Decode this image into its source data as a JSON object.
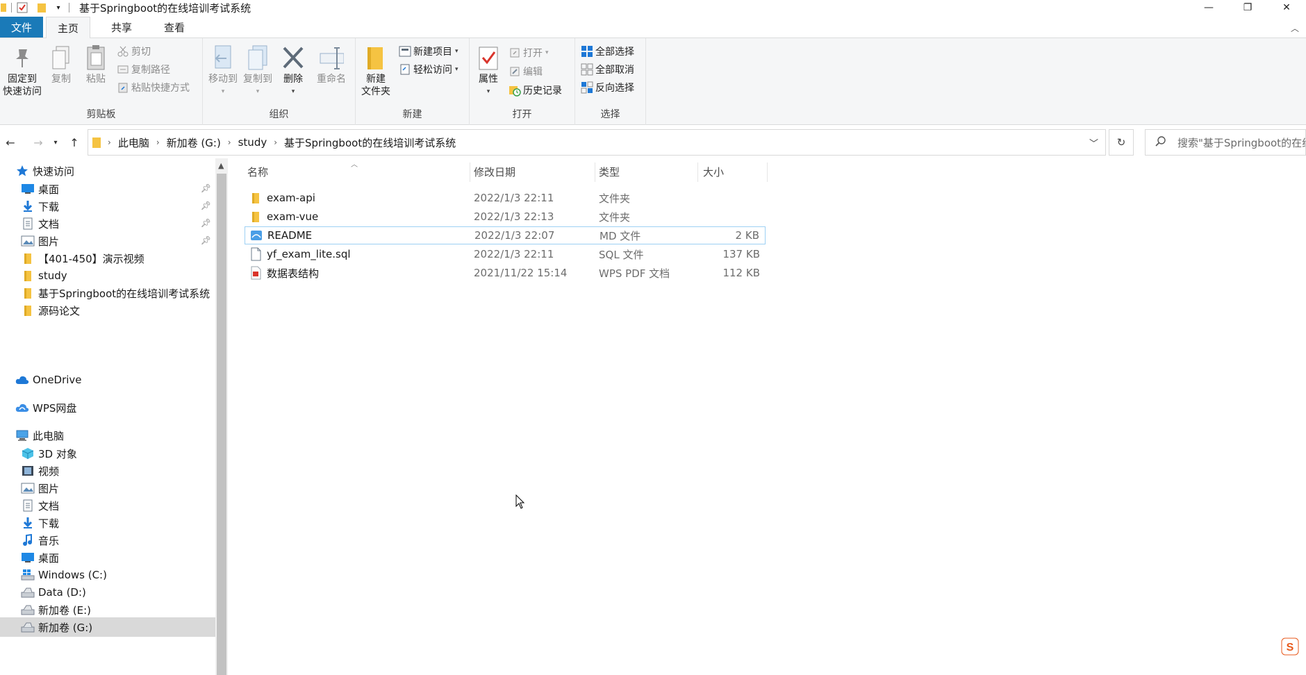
{
  "window": {
    "title": "基于Springboot的在线培训考试系统",
    "controls": {
      "minimize": "—",
      "maximize": "❐",
      "close": "✕"
    }
  },
  "ribbon": {
    "tabs": [
      "文件",
      "主页",
      "共享",
      "查看"
    ],
    "active_tab": "主页",
    "groups": {
      "clipboard": {
        "label": "剪贴板",
        "pin_line1": "固定到",
        "pin_line2": "快速访问",
        "copy": "复制",
        "paste": "粘贴",
        "cut": "剪切",
        "copy_path": "复制路径",
        "paste_shortcut": "粘贴快捷方式"
      },
      "organize": {
        "label": "组织",
        "move_to": "移动到",
        "copy_to": "复制到",
        "delete": "删除",
        "rename": "重命名"
      },
      "new": {
        "label": "新建",
        "new_folder_line1": "新建",
        "new_folder_line2": "文件夹",
        "new_item": "新建项目",
        "easy_access": "轻松访问"
      },
      "open": {
        "label": "打开",
        "properties": "属性",
        "open": "打开",
        "edit": "编辑",
        "history": "历史记录"
      },
      "select": {
        "label": "选择",
        "select_all": "全部选择",
        "select_none": "全部取消",
        "invert": "反向选择"
      }
    }
  },
  "address": {
    "crumbs": [
      "此电脑",
      "新加卷 (G:)",
      "study",
      "基于Springboot的在线培训考试系统"
    ],
    "search_placeholder": "搜索\"基于Springboot的在线培训考试系统\""
  },
  "navpane": {
    "quick_access": "快速访问",
    "quick_items": [
      {
        "label": "桌面",
        "icon": "desktop-icon",
        "pinned": true
      },
      {
        "label": "下载",
        "icon": "download-icon",
        "pinned": true
      },
      {
        "label": "文档",
        "icon": "document-icon",
        "pinned": true
      },
      {
        "label": "图片",
        "icon": "picture-icon",
        "pinned": true
      },
      {
        "label": "【401-450】演示视频",
        "icon": "folder-icon",
        "pinned": false
      },
      {
        "label": "study",
        "icon": "folder-icon",
        "pinned": false
      },
      {
        "label": "基于Springboot的在线培训考试系统",
        "icon": "folder-icon",
        "pinned": false
      },
      {
        "label": "源码论文",
        "icon": "folder-icon",
        "pinned": false
      }
    ],
    "onedrive": "OneDrive",
    "wps": "WPS网盘",
    "this_pc": "此电脑",
    "pc_items": [
      {
        "label": "3D 对象",
        "icon": "3d-objects-icon"
      },
      {
        "label": "视频",
        "icon": "video-icon"
      },
      {
        "label": "图片",
        "icon": "picture-icon"
      },
      {
        "label": "文档",
        "icon": "document-icon"
      },
      {
        "label": "下载",
        "icon": "download-icon"
      },
      {
        "label": "音乐",
        "icon": "music-icon"
      },
      {
        "label": "桌面",
        "icon": "desktop-icon"
      },
      {
        "label": "Windows (C:)",
        "icon": "windows-drive-icon"
      },
      {
        "label": "Data (D:)",
        "icon": "drive-icon"
      },
      {
        "label": "新加卷 (E:)",
        "icon": "drive-icon"
      },
      {
        "label": "新加卷 (G:)",
        "icon": "drive-icon"
      }
    ]
  },
  "filelist": {
    "columns": [
      "名称",
      "修改日期",
      "类型",
      "大小"
    ],
    "rows": [
      {
        "name": "exam-api",
        "date": "2022/1/3 22:11",
        "type": "文件夹",
        "size": "",
        "icon": "folder-icon"
      },
      {
        "name": "exam-vue",
        "date": "2022/1/3 22:13",
        "type": "文件夹",
        "size": "",
        "icon": "folder-icon"
      },
      {
        "name": "README",
        "date": "2022/1/3 22:07",
        "type": "MD 文件",
        "size": "2 KB",
        "icon": "md-file-icon"
      },
      {
        "name": "yf_exam_lite.sql",
        "date": "2022/1/3 22:11",
        "type": "SQL 文件",
        "size": "137 KB",
        "icon": "sql-file-icon"
      },
      {
        "name": "数据表结构",
        "date": "2021/11/22 15:14",
        "type": "WPS PDF 文档",
        "size": "112 KB",
        "icon": "pdf-file-icon"
      }
    ]
  },
  "colors": {
    "file_tab": "#1a7ab8",
    "selection": "#cce8ff",
    "folder": "#f5c342",
    "accent_blue": "#1e78d6"
  }
}
